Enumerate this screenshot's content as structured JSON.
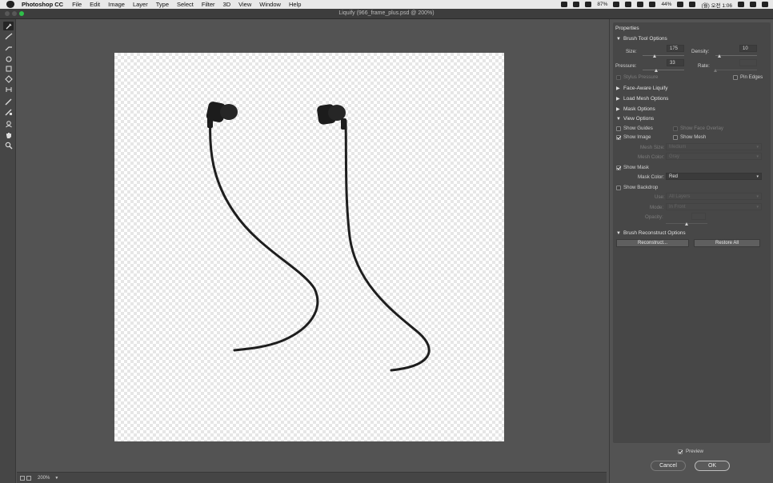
{
  "menubar": {
    "app_name": "Photoshop CC",
    "items": [
      "File",
      "Edit",
      "Image",
      "Layer",
      "Type",
      "Select",
      "Filter",
      "3D",
      "View",
      "Window",
      "Help"
    ],
    "status": {
      "battery_label": "44%",
      "clock": "(월) 오전 1:06",
      "network_speed": "87%"
    }
  },
  "window": {
    "title": "Liquify (966_frame_plus.psd @ 200%)"
  },
  "tools": [
    "forward-warp",
    "reconstruct",
    "smooth",
    "twirl-clockwise",
    "pucker",
    "bloat",
    "push-left",
    "freeze-mask",
    "thaw-mask",
    "face-tool",
    "hand",
    "zoom"
  ],
  "status_bar": {
    "zoom": "200%"
  },
  "properties": {
    "header": "Properties",
    "brush_tool_options": {
      "title": "Brush Tool Options",
      "size_label": "Size:",
      "size_value": "175",
      "size_fraction": 0.3,
      "density_label": "Density:",
      "density_value": "10",
      "density_fraction": 0.1,
      "pressure_label": "Pressure:",
      "pressure_value": "33",
      "pressure_fraction": 0.33,
      "rate_label": "Rate:",
      "rate_value": "",
      "rate_fraction": 0.0,
      "stylus_pressure": "Stylus Pressure",
      "stylus_pressure_checked": false,
      "pin_edges": "Pin Edges",
      "pin_edges_checked": false
    },
    "collapsed_sections": [
      "Face-Aware Liquify",
      "Load Mesh Options",
      "Mask Options"
    ],
    "view_options": {
      "title": "View Options",
      "show_guides": "Show Guides",
      "show_guides_checked": false,
      "show_face_overlay": "Show Face Overlay",
      "show_face_overlay_checked": false,
      "show_image": "Show Image",
      "show_image_checked": true,
      "show_mesh": "Show Mesh",
      "show_mesh_checked": false,
      "mesh_size_label": "Mesh Size:",
      "mesh_size_value": "Medium",
      "mesh_color_label": "Mesh Color:",
      "mesh_color_value": "Gray",
      "show_mask": "Show Mask",
      "show_mask_checked": true,
      "mask_color_label": "Mask Color:",
      "mask_color_value": "Red",
      "show_backdrop": "Show Backdrop",
      "show_backdrop_checked": false,
      "use_label": "Use:",
      "use_value": "All Layers",
      "mode_label": "Mode:",
      "mode_value": "In Front",
      "opacity_label": "Opacity:",
      "opacity_value": "",
      "opacity_fraction": 0.5
    },
    "reconstruct": {
      "title": "Brush Reconstruct Options",
      "reconstruct_button": "Reconstruct...",
      "restore_all_button": "Restore All"
    }
  },
  "footer": {
    "preview_label": "Preview",
    "preview_checked": true,
    "cancel": "Cancel",
    "ok": "OK"
  },
  "colors": {
    "mask_color": "#cc0000",
    "accent": "#7a7a7a",
    "earphone": "#1e1e1e"
  }
}
